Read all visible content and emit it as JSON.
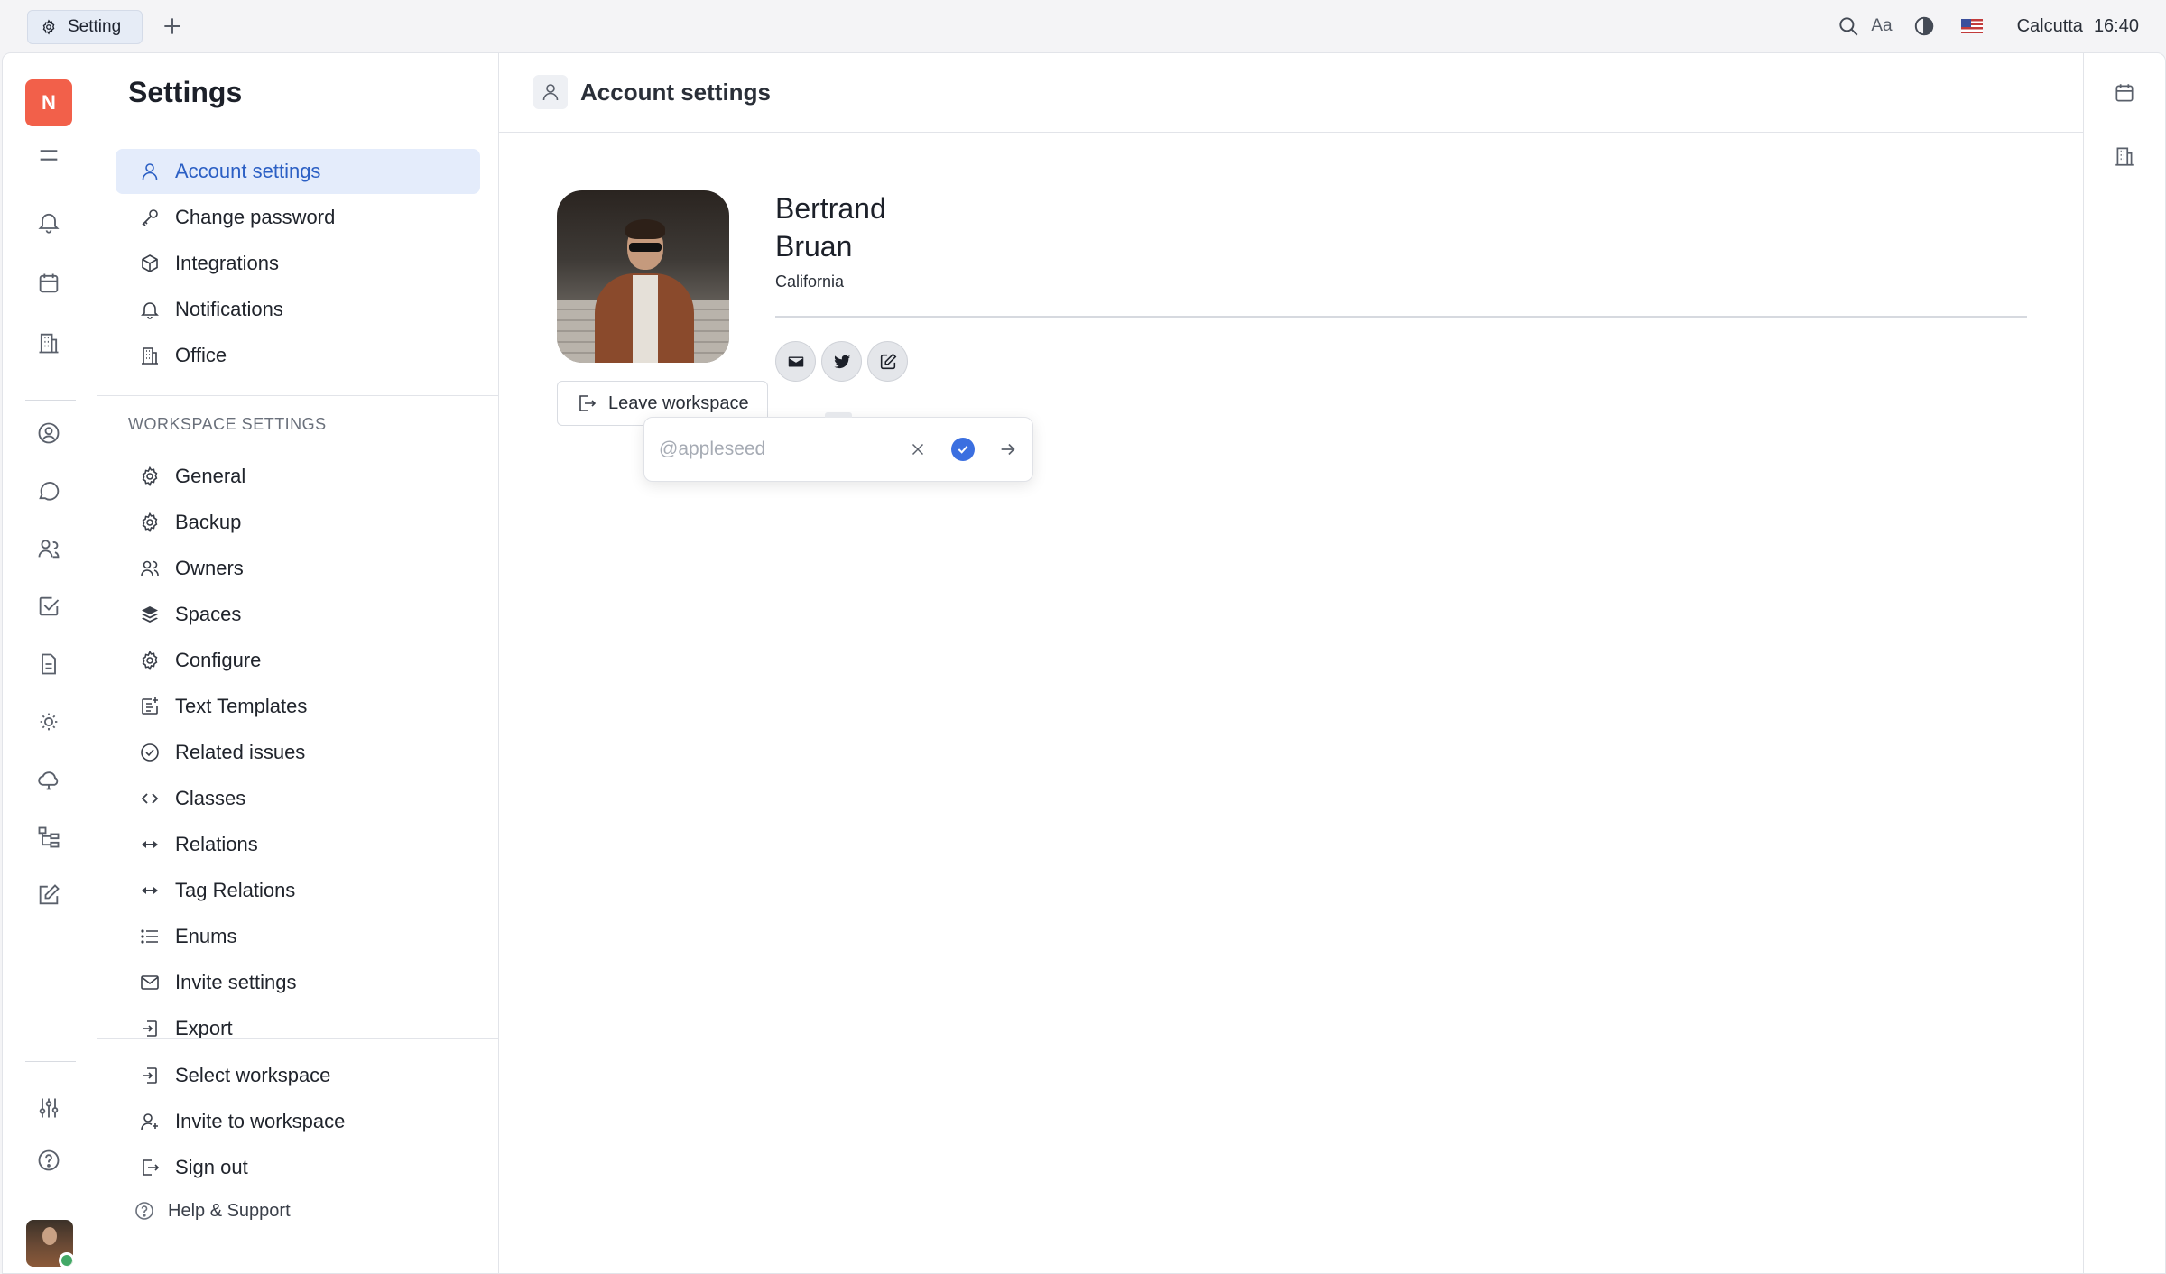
{
  "topbar": {
    "tab_label": "Setting",
    "tab_icon": "gear-icon",
    "new_tab_icon": "plus-icon",
    "font_size_label": "Aa",
    "timezone": "Calcutta",
    "time": "16:40",
    "icons": [
      "search-icon",
      "contrast-icon",
      "us-flag-icon"
    ]
  },
  "rail": {
    "logo_letter": "N",
    "icons": [
      "menu-icon",
      "bell-icon",
      "calendar-icon",
      "office-building-icon",
      "person-circle-icon",
      "chat-icon",
      "contacts-icon",
      "tasks-checkbox-icon",
      "document-icon",
      "sun-icon",
      "cloud-icon",
      "tree-icon",
      "edit-icon",
      "sliders-icon",
      "help-icon"
    ]
  },
  "nav": {
    "title": "Settings",
    "account_items": [
      {
        "label": "Account settings",
        "icon": "person-icon",
        "active": true
      },
      {
        "label": "Change password",
        "icon": "key-icon"
      },
      {
        "label": "Integrations",
        "icon": "cube-icon"
      },
      {
        "label": "Notifications",
        "icon": "bell-icon"
      },
      {
        "label": "Office",
        "icon": "office-building-icon"
      }
    ],
    "workspace_label": "WORKSPACE SETTINGS",
    "workspace_items": [
      {
        "label": "General",
        "icon": "gear-icon"
      },
      {
        "label": "Backup",
        "icon": "gear-icon"
      },
      {
        "label": "Owners",
        "icon": "people-icon"
      },
      {
        "label": "Spaces",
        "icon": "layers-icon"
      },
      {
        "label": "Configure",
        "icon": "gear-icon"
      },
      {
        "label": "Text Templates",
        "icon": "text-template-icon"
      },
      {
        "label": "Related issues",
        "icon": "check-circle-icon"
      },
      {
        "label": "Classes",
        "icon": "code-icon"
      },
      {
        "label": "Relations",
        "icon": "double-arrow-icon"
      },
      {
        "label": "Tag Relations",
        "icon": "double-arrow-icon"
      },
      {
        "label": "Enums",
        "icon": "list-icon"
      },
      {
        "label": "Invite settings",
        "icon": "envelope-icon"
      },
      {
        "label": "Export",
        "icon": "export-icon"
      }
    ],
    "bottom_items": [
      {
        "label": "Select workspace",
        "icon": "enter-icon"
      },
      {
        "label": "Invite to workspace",
        "icon": "person-add-icon"
      },
      {
        "label": "Sign out",
        "icon": "sign-out-icon"
      }
    ],
    "help_label": "Help & Support"
  },
  "main": {
    "header_title": "Account settings",
    "first_name": "Bertrand",
    "last_name": "Bruan",
    "location": "California",
    "leave_label": "Leave workspace",
    "social_icons": [
      "mail-icon",
      "twitter-icon",
      "edit-icon"
    ],
    "popup": {
      "placeholder": "@appleseed",
      "value": ""
    }
  },
  "right_rail": {
    "icons": [
      "calendar-icon",
      "office-building-icon"
    ]
  }
}
